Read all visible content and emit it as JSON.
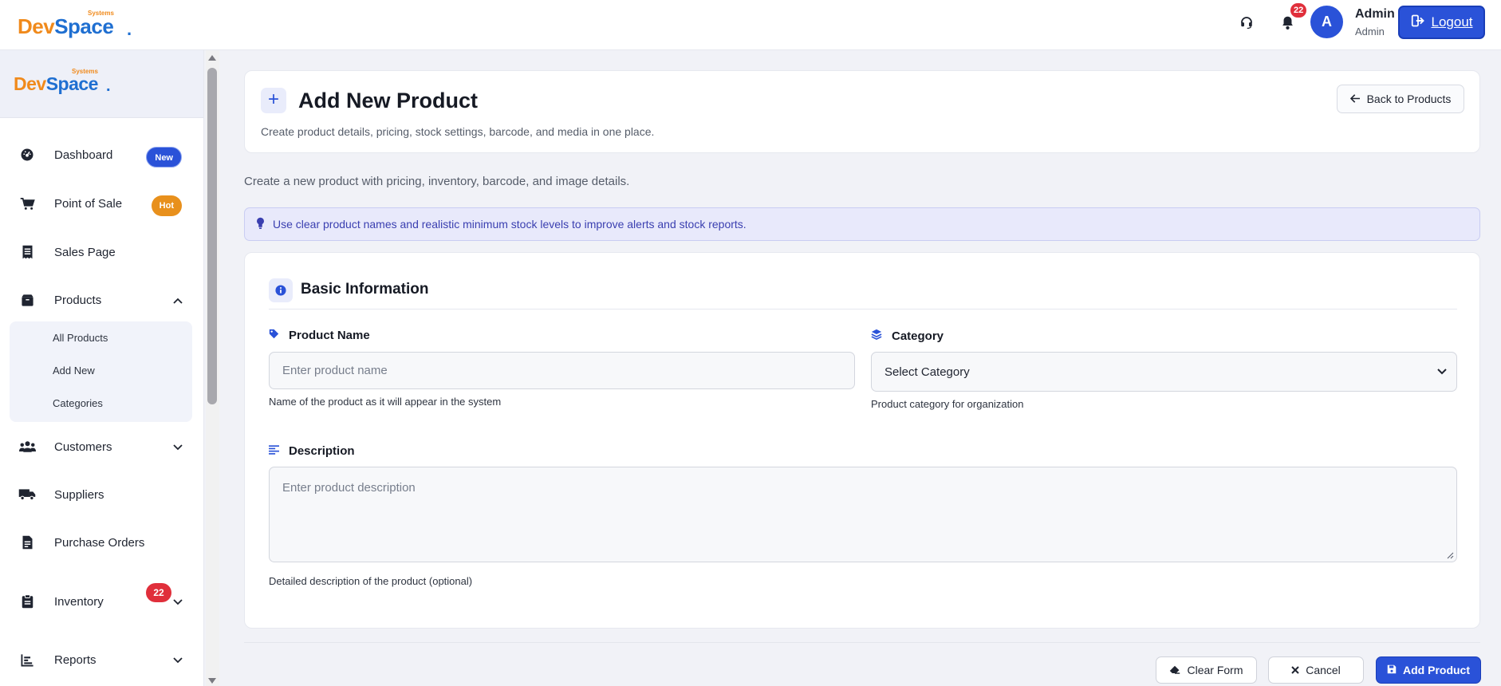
{
  "brand": {
    "top_text": "Systems",
    "dev": "Dev",
    "space": "Space",
    "dot": "."
  },
  "topbar": {
    "notification_count": "22",
    "avatar_letter": "A",
    "user_name": "Admin",
    "user_role": "Admin",
    "logout_label": "Logout",
    "icons": [
      "headset-icon",
      "bell-icon",
      "logout-icon"
    ]
  },
  "sidebar": {
    "items": [
      {
        "label": "Dashboard",
        "icon": "dashboard-icon",
        "badge": "New"
      },
      {
        "label": "Point of Sale",
        "icon": "cart-icon",
        "badge": "Hot"
      },
      {
        "label": "Sales Page",
        "icon": "receipt-icon"
      },
      {
        "label": "Products",
        "icon": "box-icon",
        "expanded": true
      },
      {
        "label": "Customers",
        "icon": "users-icon"
      },
      {
        "label": "Suppliers",
        "icon": "truck-icon"
      },
      {
        "label": "Purchase Orders",
        "icon": "file-invoice-icon"
      },
      {
        "label": "Inventory",
        "icon": "clipboard-icon",
        "badge": "22"
      },
      {
        "label": "Reports",
        "icon": "chart-icon"
      }
    ],
    "products_submenu": [
      "All Products",
      "Add New",
      "Categories"
    ]
  },
  "header": {
    "title": "Add New Product",
    "subtitle": "Create product details, pricing, stock settings, barcode, and media in one place.",
    "back_label": "Back to Products"
  },
  "intro": "Create a new product with pricing, inventory, barcode, and image details.",
  "tip": "Use clear product names and realistic minimum stock levels to improve alerts and stock reports.",
  "section": {
    "title": "Basic Information",
    "product_name": {
      "label": "Product Name",
      "placeholder": "Enter product name",
      "help": "Name of the product as it will appear in the system"
    },
    "category": {
      "label": "Category",
      "value": "Select Category",
      "help": "Product category for organization"
    },
    "description": {
      "label": "Description",
      "placeholder": "Enter product description",
      "help": "Detailed description of the product (optional)"
    }
  },
  "actions": {
    "clear": "Clear Form",
    "cancel": "Cancel",
    "add": "Add Product"
  },
  "colors": {
    "primary": "#2a52d8",
    "orange": "#f08a1c",
    "danger": "#e02f3b",
    "tip_bg": "#e8e9fb"
  }
}
